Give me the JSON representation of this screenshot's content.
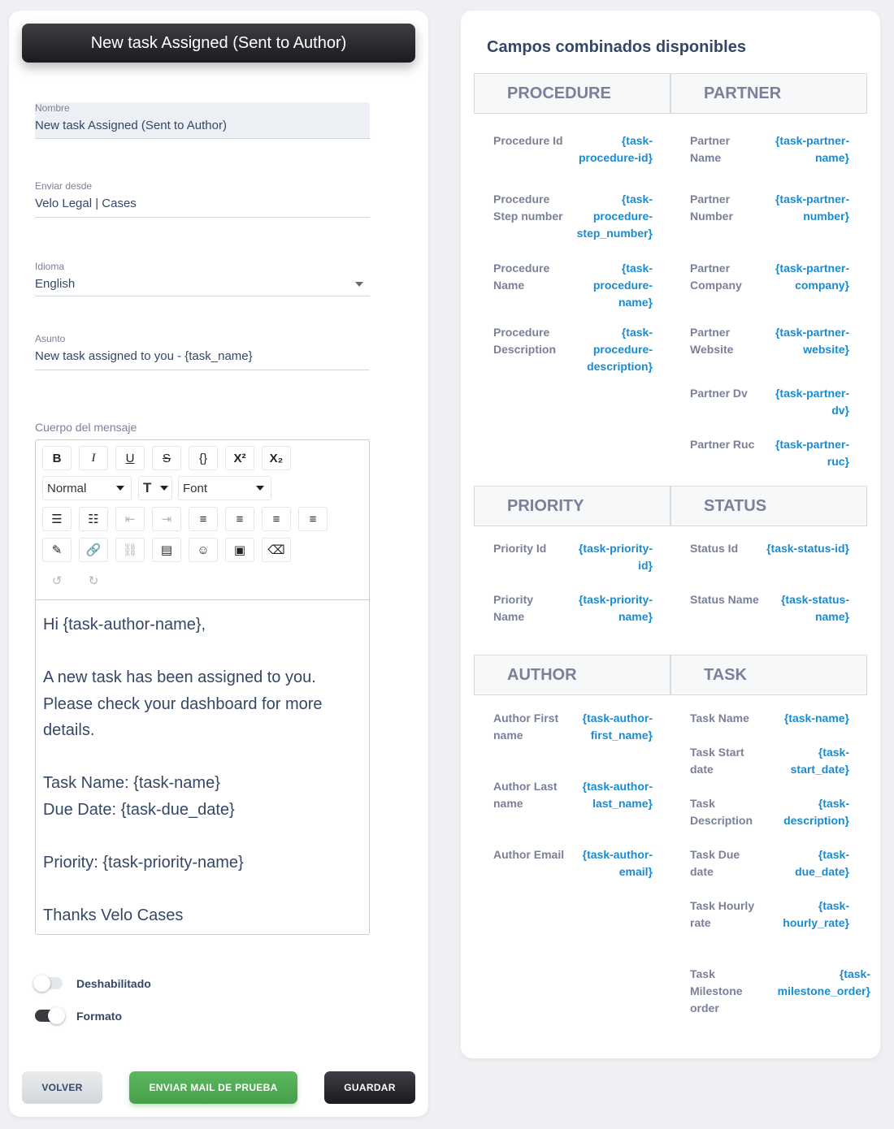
{
  "header": {
    "title": "New task Assigned (Sent to Author)"
  },
  "form": {
    "nombre": {
      "label": "Nombre",
      "value": "New task Assigned (Sent to Author)"
    },
    "enviar_desde": {
      "label": "Enviar desde",
      "value": "Velo Legal | Cases"
    },
    "idioma": {
      "label": "Idioma",
      "value": "English"
    },
    "asunto": {
      "label": "Asunto",
      "value": "New task assigned to you - {task_name}"
    }
  },
  "editor": {
    "label": "Cuerpo del mensaje",
    "toolbar": {
      "format_buttons": [
        {
          "icon": "bold-icon",
          "glyph": "B"
        },
        {
          "icon": "italic-icon",
          "glyph": "I"
        },
        {
          "icon": "underline-icon",
          "glyph": "U"
        },
        {
          "icon": "strikethrough-icon",
          "glyph": "S"
        },
        {
          "icon": "code-icon",
          "glyph": "{}"
        },
        {
          "icon": "superscript-icon",
          "glyph": "X²"
        },
        {
          "icon": "subscript-icon",
          "glyph": "X₂"
        }
      ],
      "heading_select": "Normal",
      "font_select": "Font",
      "align_buttons": [
        {
          "icon": "bullet-list-icon",
          "glyph": "☰"
        },
        {
          "icon": "numbered-list-icon",
          "glyph": "☷"
        },
        {
          "icon": "outdent-icon",
          "glyph": "⇤"
        },
        {
          "icon": "indent-icon",
          "glyph": "⇥"
        },
        {
          "icon": "align-left-icon",
          "glyph": "≡"
        },
        {
          "icon": "align-center-icon",
          "glyph": "≡"
        },
        {
          "icon": "align-right-icon",
          "glyph": "≡"
        },
        {
          "icon": "align-justify-icon",
          "glyph": "≡"
        }
      ],
      "insert_buttons": [
        {
          "icon": "color-picker-icon",
          "glyph": "✎"
        },
        {
          "icon": "link-icon",
          "glyph": "🔗"
        },
        {
          "icon": "unlink-icon",
          "glyph": "⛓"
        },
        {
          "icon": "html-icon",
          "glyph": "▤"
        },
        {
          "icon": "emoji-icon",
          "glyph": "☺"
        },
        {
          "icon": "image-icon",
          "glyph": "▣"
        },
        {
          "icon": "eraser-icon",
          "glyph": "⌫"
        }
      ],
      "history_buttons": [
        {
          "icon": "undo-icon",
          "glyph": "↺"
        },
        {
          "icon": "redo-icon",
          "glyph": "↻"
        }
      ]
    },
    "body_lines": [
      "Hi {task-author-name},",
      "",
      "A new task has been assigned to you. Please check your dashboard for more details.",
      "",
      "Task Name: {task-name}",
      "Due Date: {task-due_date}",
      "",
      "Priority: {task-priority-name}",
      "",
      "Thanks Velo Cases"
    ]
  },
  "toggles": {
    "deshabilitado": {
      "label": "Deshabilitado",
      "on": false
    },
    "formato": {
      "label": "Formato",
      "on": true
    }
  },
  "buttons": {
    "volver": "VOLVER",
    "enviar": "ENVIAR MAIL DE PRUEBA",
    "guardar": "GUARDAR"
  },
  "colors": {
    "accent_blue": "#1a8bd0",
    "green": "#4caf50",
    "dark": "#1f1f22"
  },
  "merge_fields": {
    "title": "Campos combinados disponibles",
    "sections": [
      {
        "name": "PROCEDURE",
        "items": [
          {
            "label": "Procedure Id",
            "tag": "{task-procedure-id}"
          },
          {
            "label": "Procedure Step number",
            "tag": "{task-procedure-step_number}"
          },
          {
            "label": "Procedure Name",
            "tag": "{task-procedure-name}"
          },
          {
            "label": "Procedure Description",
            "tag": "{task-procedure-description}"
          }
        ]
      },
      {
        "name": "PARTNER",
        "items": [
          {
            "label": "Partner Name",
            "tag": "{task-partner-name}"
          },
          {
            "label": "Partner Number",
            "tag": "{task-partner-number}"
          },
          {
            "label": "Partner Company",
            "tag": "{task-partner-company}"
          },
          {
            "label": "Partner Website",
            "tag": "{task-partner-website}"
          },
          {
            "label": "Partner Dv",
            "tag": "{task-partner-dv}"
          },
          {
            "label": "Partner Ruc",
            "tag": "{task-partner-ruc}"
          }
        ]
      },
      {
        "name": "PRIORITY",
        "items": [
          {
            "label": "Priority Id",
            "tag": "{task-priority-id}"
          },
          {
            "label": "Priority Name",
            "tag": "{task-priority-name}"
          }
        ]
      },
      {
        "name": "STATUS",
        "items": [
          {
            "label": "Status Id",
            "tag": "{task-status-id}"
          },
          {
            "label": "Status Name",
            "tag": "{task-status-name}"
          }
        ]
      },
      {
        "name": "AUTHOR",
        "items": [
          {
            "label": "Author First name",
            "tag": "{task-author-first_name}"
          },
          {
            "label": "Author Last name",
            "tag": "{task-author-last_name}"
          },
          {
            "label": "Author Email",
            "tag": "{task-author-email}"
          }
        ]
      },
      {
        "name": "TASK",
        "items": [
          {
            "label": "Task Name",
            "tag": "{task-name}"
          },
          {
            "label": "Task Start date",
            "tag": "{task-start_date}"
          },
          {
            "label": "Task Description",
            "tag": "{task-description}"
          },
          {
            "label": "Task Due date",
            "tag": "{task-due_date}"
          },
          {
            "label": "Task Hourly rate",
            "tag": "{task-hourly_rate}"
          },
          {
            "label": "Task Milestone order",
            "tag": "{task-milestone_order}"
          }
        ]
      }
    ]
  }
}
